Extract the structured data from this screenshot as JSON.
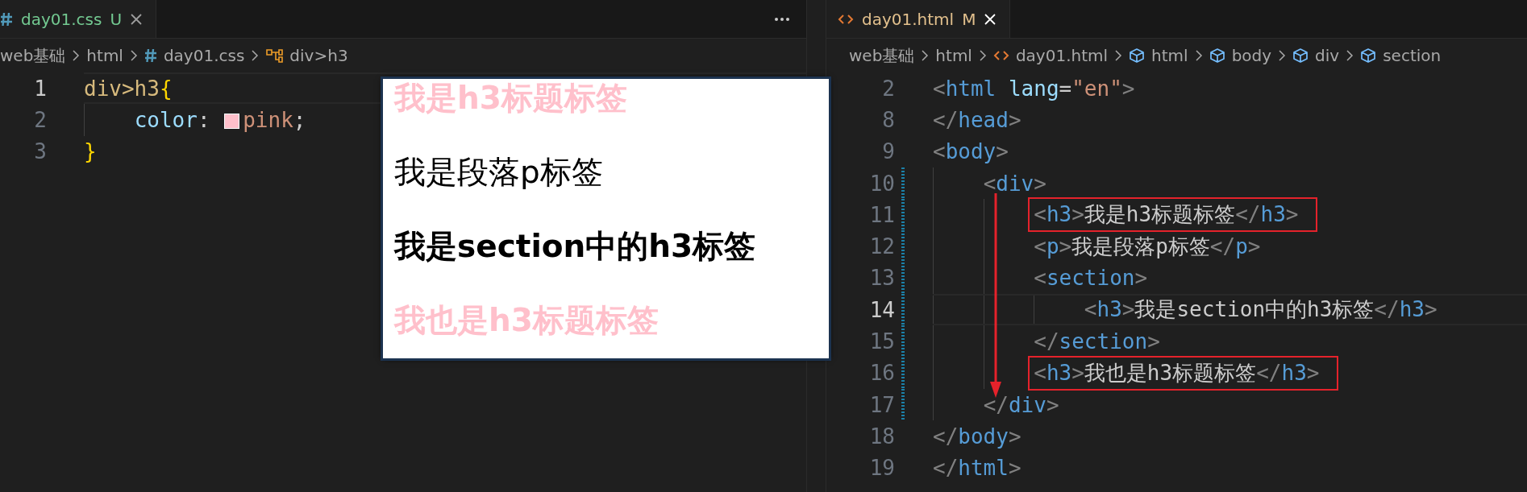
{
  "left_editor": {
    "tab": {
      "kind": "css",
      "label": "day01.css",
      "status": {
        "kind": "untracked",
        "text": "U"
      },
      "selected": true
    },
    "breadcrumbs": [
      {
        "kind": "folder",
        "text": "web基础"
      },
      {
        "kind": "folder",
        "text": "html"
      },
      {
        "kind": "css",
        "text": "day01.css"
      },
      {
        "kind": "selector",
        "text": "div>h3"
      }
    ],
    "lines": [
      {
        "number": "1",
        "current": true,
        "boxed": false,
        "tokens": [
          {
            "kind": "selector",
            "text": "div>h3"
          },
          {
            "kind": "brace",
            "text": "{"
          }
        ]
      },
      {
        "number": "2",
        "current": false,
        "boxed": false,
        "tokens": [
          {
            "kind": "prop",
            "text": "    color"
          },
          {
            "kind": "punct",
            "text": ": "
          },
          {
            "kind": "swatch",
            "color": "#ffc0cb"
          },
          {
            "kind": "value",
            "text": "pink"
          },
          {
            "kind": "punct",
            "text": ";"
          }
        ]
      },
      {
        "number": "3",
        "current": false,
        "boxed": false,
        "tokens": [
          {
            "kind": "brace",
            "text": "}"
          }
        ]
      }
    ]
  },
  "preview": {
    "items": [
      {
        "kind": "h3",
        "text": "我是h3标题标签",
        "color": "#ffc0cb"
      },
      {
        "kind": "p",
        "text": "我是段落p标签",
        "color": "#000000"
      },
      {
        "kind": "h3",
        "text": "我是section中的h3标签",
        "color": "#000000"
      },
      {
        "kind": "h3",
        "text": "我也是h3标题标签",
        "color": "#ffc0cb"
      }
    ]
  },
  "right_editor": {
    "tab": {
      "kind": "html",
      "label": "day01.html",
      "status": {
        "kind": "modified",
        "text": "M"
      },
      "selected": true
    },
    "breadcrumbs": [
      {
        "kind": "folder",
        "text": "web基础"
      },
      {
        "kind": "folder",
        "text": "html"
      },
      {
        "kind": "html",
        "text": "day01.html"
      },
      {
        "kind": "element",
        "text": "html"
      },
      {
        "kind": "element",
        "text": "body"
      },
      {
        "kind": "element",
        "text": "div"
      },
      {
        "kind": "element",
        "text": "section"
      }
    ],
    "lines": [
      {
        "number": "2",
        "current": false,
        "boxed": false,
        "modified": false,
        "tokens": [
          {
            "kind": "br",
            "text": "<"
          },
          {
            "kind": "tag",
            "text": "html"
          },
          {
            "kind": "attr",
            "text": " lang"
          },
          {
            "kind": "punct",
            "text": "="
          },
          {
            "kind": "str",
            "text": "\"en\""
          },
          {
            "kind": "br",
            "text": ">"
          }
        ]
      },
      {
        "number": "8",
        "current": false,
        "boxed": false,
        "modified": false,
        "tokens": [
          {
            "kind": "br",
            "text": "</"
          },
          {
            "kind": "tag",
            "text": "head"
          },
          {
            "kind": "br",
            "text": ">"
          }
        ]
      },
      {
        "number": "9",
        "current": false,
        "boxed": false,
        "modified": false,
        "tokens": [
          {
            "kind": "br",
            "text": "<"
          },
          {
            "kind": "tag",
            "text": "body"
          },
          {
            "kind": "br",
            "text": ">"
          }
        ]
      },
      {
        "number": "10",
        "current": false,
        "boxed": false,
        "modified": true,
        "tokens": [
          {
            "kind": "br",
            "text": "    <"
          },
          {
            "kind": "tag",
            "text": "div"
          },
          {
            "kind": "br",
            "text": ">"
          }
        ]
      },
      {
        "number": "11",
        "current": false,
        "boxed": true,
        "modified": true,
        "tokens": [
          {
            "kind": "br",
            "text": "        <"
          },
          {
            "kind": "tag",
            "text": "h3"
          },
          {
            "kind": "br",
            "text": ">"
          },
          {
            "kind": "text",
            "text": "我是h3标题标签"
          },
          {
            "kind": "br",
            "text": "</"
          },
          {
            "kind": "tag",
            "text": "h3"
          },
          {
            "kind": "br",
            "text": ">"
          }
        ]
      },
      {
        "number": "12",
        "current": false,
        "boxed": false,
        "modified": true,
        "tokens": [
          {
            "kind": "br",
            "text": "        <"
          },
          {
            "kind": "tag",
            "text": "p"
          },
          {
            "kind": "br",
            "text": ">"
          },
          {
            "kind": "text",
            "text": "我是段落p标签"
          },
          {
            "kind": "br",
            "text": "</"
          },
          {
            "kind": "tag",
            "text": "p"
          },
          {
            "kind": "br",
            "text": ">"
          }
        ]
      },
      {
        "number": "13",
        "current": false,
        "boxed": false,
        "modified": true,
        "tokens": [
          {
            "kind": "br",
            "text": "        <"
          },
          {
            "kind": "tag",
            "text": "section"
          },
          {
            "kind": "br",
            "text": ">"
          }
        ]
      },
      {
        "number": "14",
        "current": true,
        "boxed": false,
        "modified": true,
        "tokens": [
          {
            "kind": "br",
            "text": "            <"
          },
          {
            "kind": "tag",
            "text": "h3"
          },
          {
            "kind": "br",
            "text": ">"
          },
          {
            "kind": "text",
            "text": "我是section中的h3标签"
          },
          {
            "kind": "br",
            "text": "</"
          },
          {
            "kind": "tag",
            "text": "h3"
          },
          {
            "kind": "br",
            "text": ">"
          }
        ]
      },
      {
        "number": "15",
        "current": false,
        "boxed": false,
        "modified": true,
        "tokens": [
          {
            "kind": "br",
            "text": "        </"
          },
          {
            "kind": "tag",
            "text": "section"
          },
          {
            "kind": "br",
            "text": ">"
          }
        ]
      },
      {
        "number": "16",
        "current": false,
        "boxed": true,
        "modified": true,
        "tokens": [
          {
            "kind": "br",
            "text": "        <"
          },
          {
            "kind": "tag",
            "text": "h3"
          },
          {
            "kind": "br",
            "text": ">"
          },
          {
            "kind": "text",
            "text": "我也是h3标题标签"
          },
          {
            "kind": "br",
            "text": "</"
          },
          {
            "kind": "tag",
            "text": "h3"
          },
          {
            "kind": "br",
            "text": ">"
          }
        ]
      },
      {
        "number": "17",
        "current": false,
        "boxed": false,
        "modified": true,
        "tokens": [
          {
            "kind": "br",
            "text": "    </"
          },
          {
            "kind": "tag",
            "text": "div"
          },
          {
            "kind": "br",
            "text": ">"
          }
        ]
      },
      {
        "number": "18",
        "current": false,
        "boxed": false,
        "modified": false,
        "tokens": [
          {
            "kind": "br",
            "text": "</"
          },
          {
            "kind": "tag",
            "text": "body"
          },
          {
            "kind": "br",
            "text": ">"
          }
        ]
      },
      {
        "number": "19",
        "current": false,
        "boxed": false,
        "modified": false,
        "tokens": [
          {
            "kind": "br",
            "text": "</"
          },
          {
            "kind": "tag",
            "text": "html"
          },
          {
            "kind": "br",
            "text": ">"
          }
        ]
      }
    ]
  }
}
